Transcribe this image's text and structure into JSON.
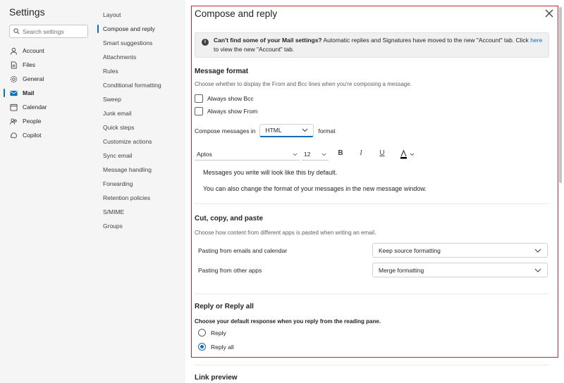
{
  "settings_nav": {
    "title": "Settings",
    "search_placeholder": "Search settings",
    "items": [
      {
        "label": "Account",
        "icon": "person-icon"
      },
      {
        "label": "Files",
        "icon": "file-icon"
      },
      {
        "label": "General",
        "icon": "gear-icon"
      },
      {
        "label": "Mail",
        "icon": "mail-icon"
      },
      {
        "label": "Calendar",
        "icon": "calendar-icon"
      },
      {
        "label": "People",
        "icon": "people-icon"
      },
      {
        "label": "Copilot",
        "icon": "copilot-icon"
      }
    ]
  },
  "mail_nav": {
    "items": [
      "Layout",
      "Compose and reply",
      "Smart suggestions",
      "Attachments",
      "Rules",
      "Conditional formatting",
      "Sweep",
      "Junk email",
      "Quick steps",
      "Customize actions",
      "Sync email",
      "Message handling",
      "Forwarding",
      "Retention policies",
      "S/MIME",
      "Groups"
    ]
  },
  "main": {
    "title": "Compose and reply",
    "banner": {
      "bold": "Can't find some of your Mail settings?",
      "text": " Automatic replies and Signatures have moved to the new \"Account\" tab. Click ",
      "link": "here",
      "text2": " to view the new \"Account\" tab."
    },
    "message_format": {
      "heading": "Message format",
      "desc": "Choose whether to display the From and Bcc lines when you're composing a message.",
      "always_bcc": "Always show Bcc",
      "always_from": "Always show From",
      "compose_label": "Compose messages in",
      "compose_value": "HTML",
      "compose_suffix": "format",
      "font": "Aptos",
      "size": "12",
      "preview1": "Messages you write will look like this by default.",
      "preview2": "You can also change the format of your messages in the new message window."
    },
    "cut_copy": {
      "heading": "Cut, copy, and paste",
      "desc": "Choose how content from different apps is pasted when writing an email.",
      "row1_label": "Pasting from emails and calendar",
      "row1_value": "Keep source formatting",
      "row2_label": "Pasting from other apps",
      "row2_value": "Merge formatting"
    },
    "reply": {
      "heading": "Reply or Reply all",
      "desc": "Choose your default response when you reply from the reading pane.",
      "opt1": "Reply",
      "opt2": "Reply all"
    },
    "link_preview": {
      "heading": "Link preview"
    }
  }
}
